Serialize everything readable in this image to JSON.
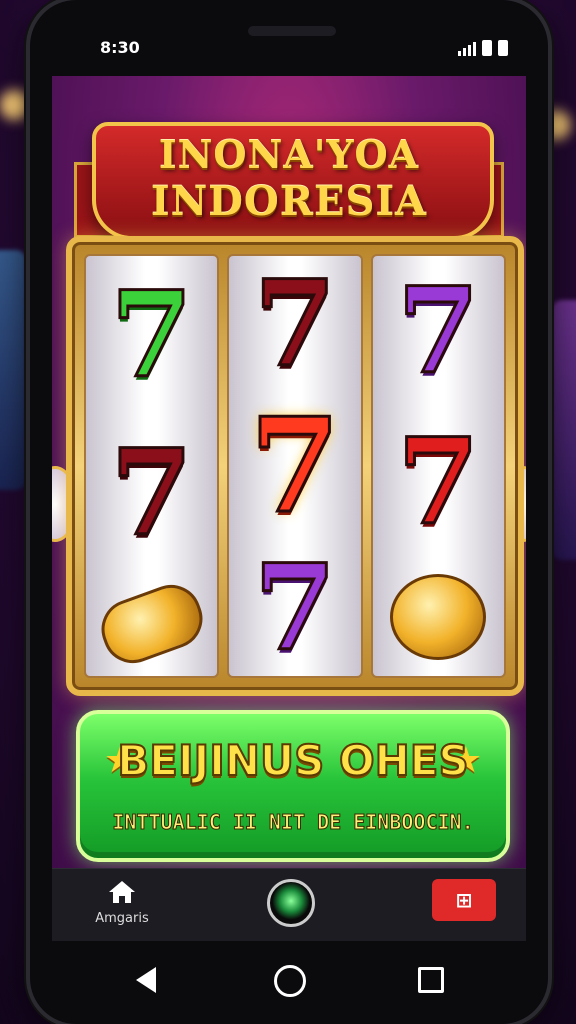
{
  "status_bar": {
    "time": "8:30",
    "icons": [
      "signal-icon",
      "battery-icon",
      "battery-icon"
    ]
  },
  "title": {
    "line1": "INONA'YOA",
    "line2": "INDORESIA"
  },
  "reels": [
    [
      "7",
      "7",
      "coin"
    ],
    [
      "7",
      "7",
      "7"
    ],
    [
      "7",
      "7",
      "coin"
    ]
  ],
  "reel_colors": [
    [
      "green",
      "darkred",
      "gold-ring"
    ],
    [
      "darkred",
      "bigred",
      "purple"
    ],
    [
      "purple",
      "red",
      "gold-coin"
    ]
  ],
  "bonus": {
    "title": "BEIJINUS OHES",
    "subtitle": "INTTUALIC II NIT DE EINBOOCIN."
  },
  "app_bar": {
    "home_label": "Amgaris",
    "action_label": "⊞"
  },
  "colors": {
    "accent_green": "#28c43a",
    "gold": "#e8b84a",
    "banner_red": "#d42a2a",
    "background_purple": "#5a1a6b"
  }
}
